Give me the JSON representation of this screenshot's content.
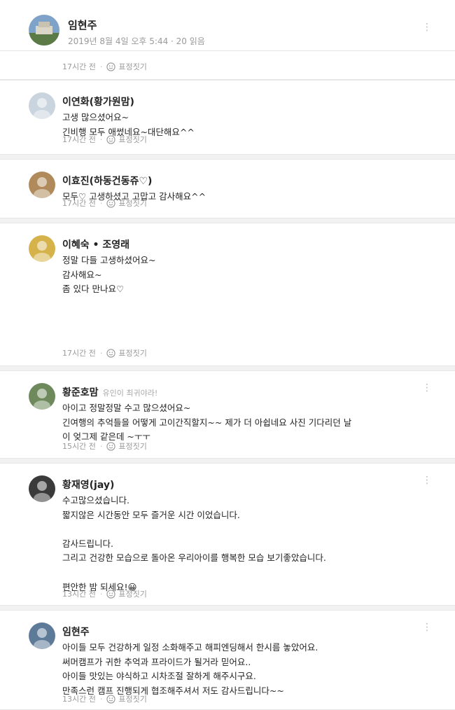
{
  "post": {
    "author": "임현주",
    "meta": "2019년 8월 4일 오후 5:44 · 20 읽음",
    "menu_icon": "more-vertical-icon"
  },
  "ui": {
    "separator": "·",
    "react_label": "표정짓기",
    "react_icon": "smiley-icon",
    "kebab_glyph": "⋮"
  },
  "comments": [
    {
      "author": "",
      "lines": [],
      "time": "17시간 전",
      "avatar_color": "#8aa0bb",
      "show_menu": false
    },
    {
      "author": "이연화(황가원맘)",
      "lines": [
        "고생 많으셨어요~",
        "긴비행 모두 애썼네요~대단해요^^"
      ],
      "time": "17시간 전",
      "avatar_color": "#c9d4df",
      "show_menu": false
    },
    {
      "author": "이효진(하동건동쥬♡)",
      "lines": [
        "모두♡ 고생하셨고 고맙고 감사해요^^"
      ],
      "time": "17시간 전",
      "avatar_color": "#b08a5a",
      "show_menu": false
    },
    {
      "author": "이혜숙 • 조영래",
      "lines": [
        "정말 다들 고생하셨어요~",
        "감사해요~",
        "좀 있다 만나요♡",
        "",
        "",
        ""
      ],
      "time": "17시간 전",
      "avatar_color": "#d6b24a",
      "show_menu": false
    },
    {
      "author": "황준호맘",
      "badge": "유인이 최귀야라!",
      "lines": [
        "아이고 정말정말 수고 많으셨어요~",
        "긴여행의 추억들을 어떻게 고이간직할지~~ 제가 더 아쉽네요 사진 기다리던 날",
        "이 엊그제 같은데 ~ㅜㅜ"
      ],
      "time": "15시간 전",
      "avatar_color": "#6e8a5c",
      "show_menu": true
    },
    {
      "author": "황재영(jay)",
      "lines": [
        "수고많으셨습니다.",
        "짧지않은 시간동안 모두 즐거운 시간 이었습니다.",
        "",
        "감사드립니다.",
        "그리고 건강한 모습으로 돌아온 우리아이를 행복한 모습 보기좋았습니다.",
        "",
        "편안한 밤 되세요!😀"
      ],
      "time": "13시간 전",
      "avatar_color": "#3a3a3a",
      "show_menu": true
    },
    {
      "author": "임현주",
      "lines": [
        "아이들 모두 건강하게 일정 소화해주고 해피엔딩해서 한시름 놓았어요.",
        "써머캠프가 귀한 추억과 프라이드가 될거라 믿어요..",
        "아이들 맛있는 야식하고 시차조절 잘하게 해주시구요.",
        "만족스런 캠프 진행되게 협조해주셔서 저도 감사드립니다~~"
      ],
      "time": "13시간 전",
      "avatar_color": "#5d7a99",
      "show_menu": true
    }
  ]
}
